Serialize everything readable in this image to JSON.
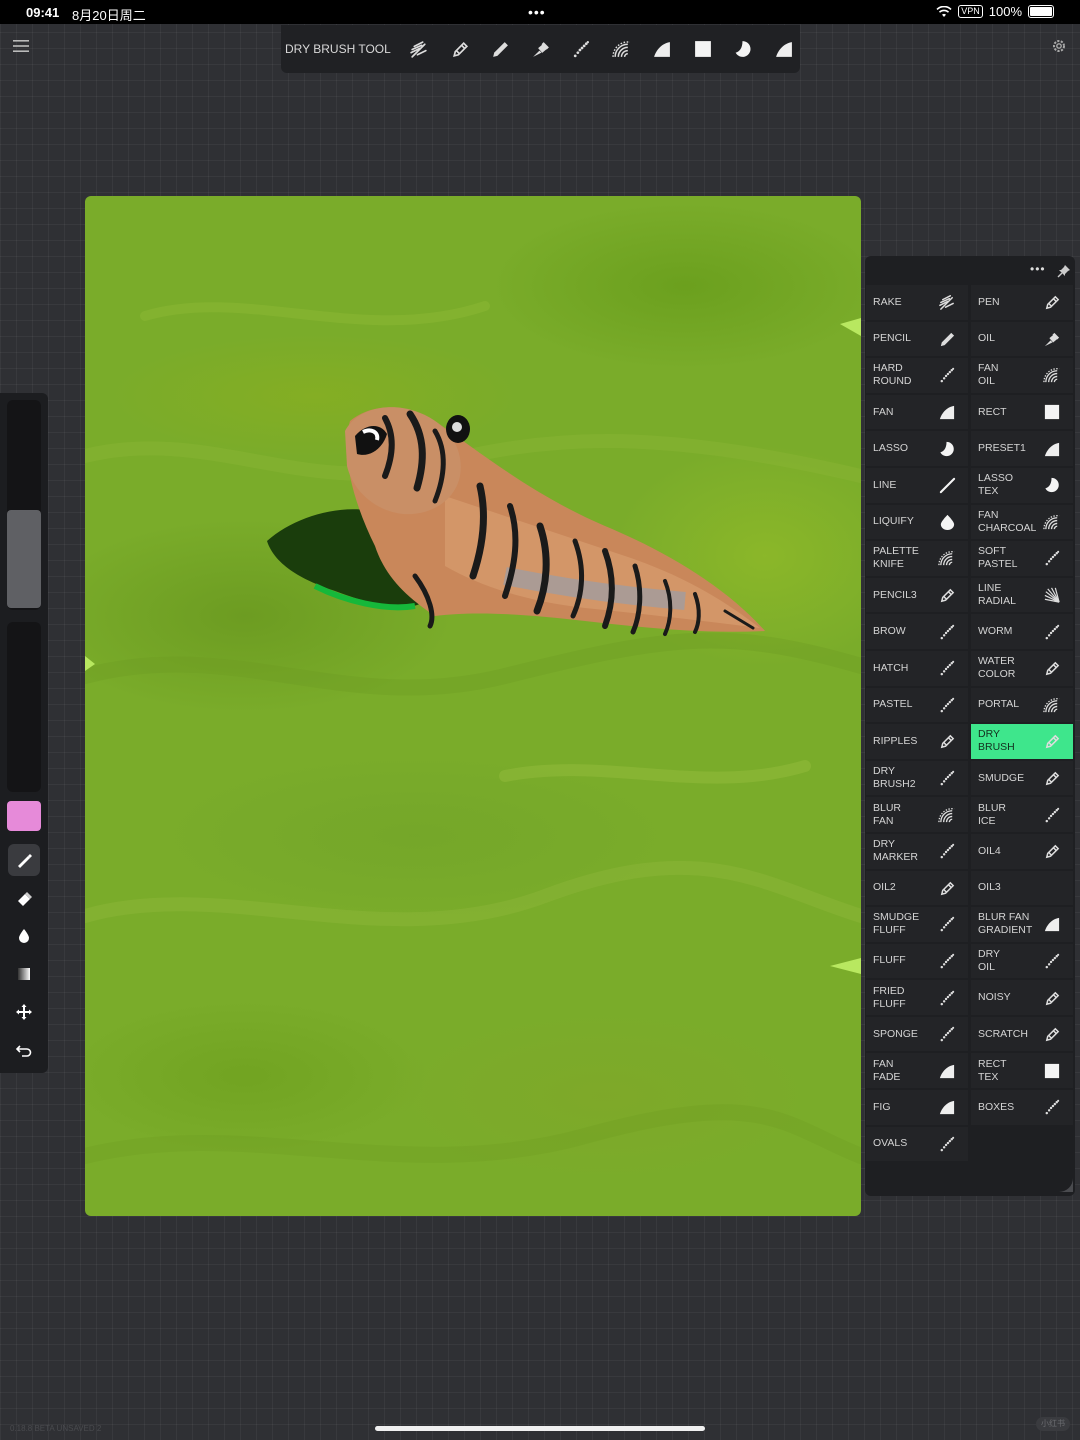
{
  "status_bar": {
    "time": "09:41",
    "date": "8月20日周二",
    "vpn": "VPN",
    "battery": "100%"
  },
  "toolbar": {
    "title": "DRY BRUSH TOOL",
    "buttons": [
      {
        "icon": "rake"
      },
      {
        "icon": "pen"
      },
      {
        "icon": "pencil"
      },
      {
        "icon": "oil"
      },
      {
        "icon": "dotted"
      },
      {
        "icon": "fan"
      },
      {
        "icon": "quarter"
      },
      {
        "icon": "rect"
      },
      {
        "icon": "lasso"
      },
      {
        "icon": "quarter"
      }
    ]
  },
  "sidebar": {
    "color": "#e68ad9",
    "brush_size_level": 0.47,
    "opacity_level": 1.0
  },
  "brush_panel": {
    "selected": "DRY\nBRUSH",
    "accent": "#3ee68c",
    "brushes": [
      {
        "label": "RAKE",
        "icon": "rake"
      },
      {
        "label": "PEN",
        "icon": "pen"
      },
      {
        "label": "PENCIL",
        "icon": "pencil"
      },
      {
        "label": "OIL",
        "icon": "oil"
      },
      {
        "label": "HARD\nROUND",
        "icon": "dotted"
      },
      {
        "label": "FAN\nOIL",
        "icon": "fan"
      },
      {
        "label": "FAN",
        "icon": "quarter"
      },
      {
        "label": "RECT",
        "icon": "rect"
      },
      {
        "label": "LASSO",
        "icon": "lasso"
      },
      {
        "label": "PRESET1",
        "icon": "quarter"
      },
      {
        "label": "LINE",
        "icon": "line"
      },
      {
        "label": "LASSO\nTEX",
        "icon": "lasso"
      },
      {
        "label": "LIQUIFY",
        "icon": "drop"
      },
      {
        "label": "FAN\nCHARCOAL",
        "icon": "fan"
      },
      {
        "label": "PALETTE\nKNIFE",
        "icon": "fan"
      },
      {
        "label": "SOFT\nPASTEL",
        "icon": "dotted"
      },
      {
        "label": "PENCIL3",
        "icon": "pen"
      },
      {
        "label": "LINE\nRADIAL",
        "icon": "radial"
      },
      {
        "label": "BROW",
        "icon": "dotted"
      },
      {
        "label": "WORM",
        "icon": "dotted"
      },
      {
        "label": "HATCH",
        "icon": "dotted"
      },
      {
        "label": "WATER\nCOLOR",
        "icon": "pen"
      },
      {
        "label": "PASTEL",
        "icon": "dotted"
      },
      {
        "label": "PORTAL",
        "icon": "fan"
      },
      {
        "label": "RIPPLES",
        "icon": "pen"
      },
      {
        "label": "DRY\nBRUSH",
        "icon": "pen"
      },
      {
        "label": "DRY\nBRUSH2",
        "icon": "dotted"
      },
      {
        "label": "SMUDGE",
        "icon": "pen"
      },
      {
        "label": "BLUR\nFAN",
        "icon": "fan"
      },
      {
        "label": "BLUR\nICE",
        "icon": "dotted"
      },
      {
        "label": "DRY\nMARKER",
        "icon": "dotted"
      },
      {
        "label": "OIL4",
        "icon": "pen"
      },
      {
        "label": "OIL2",
        "icon": "pen"
      },
      {
        "label": "OIL3",
        "icon": "none"
      },
      {
        "label": "SMUDGE\nFLUFF",
        "icon": "dotted"
      },
      {
        "label": "BLUR FAN\nGRADIENT",
        "icon": "quarter"
      },
      {
        "label": "FLUFF",
        "icon": "dotted"
      },
      {
        "label": "DRY\nOIL",
        "icon": "dotted"
      },
      {
        "label": "FRIED\nFLUFF",
        "icon": "dotted"
      },
      {
        "label": "NOISY",
        "icon": "pen"
      },
      {
        "label": "SPONGE",
        "icon": "dotted"
      },
      {
        "label": "SCRATCH",
        "icon": "pen"
      },
      {
        "label": "FAN\nFADE",
        "icon": "quarter"
      },
      {
        "label": "RECT\nTEX",
        "icon": "rect"
      },
      {
        "label": "FIG",
        "icon": "quarter"
      },
      {
        "label": "BOXES",
        "icon": "dotted"
      },
      {
        "label": "OVALS",
        "icon": "dotted"
      }
    ]
  },
  "footer": {
    "version": "0.18.8 BETA  UNSAVED 2",
    "watermark": "小红书"
  }
}
